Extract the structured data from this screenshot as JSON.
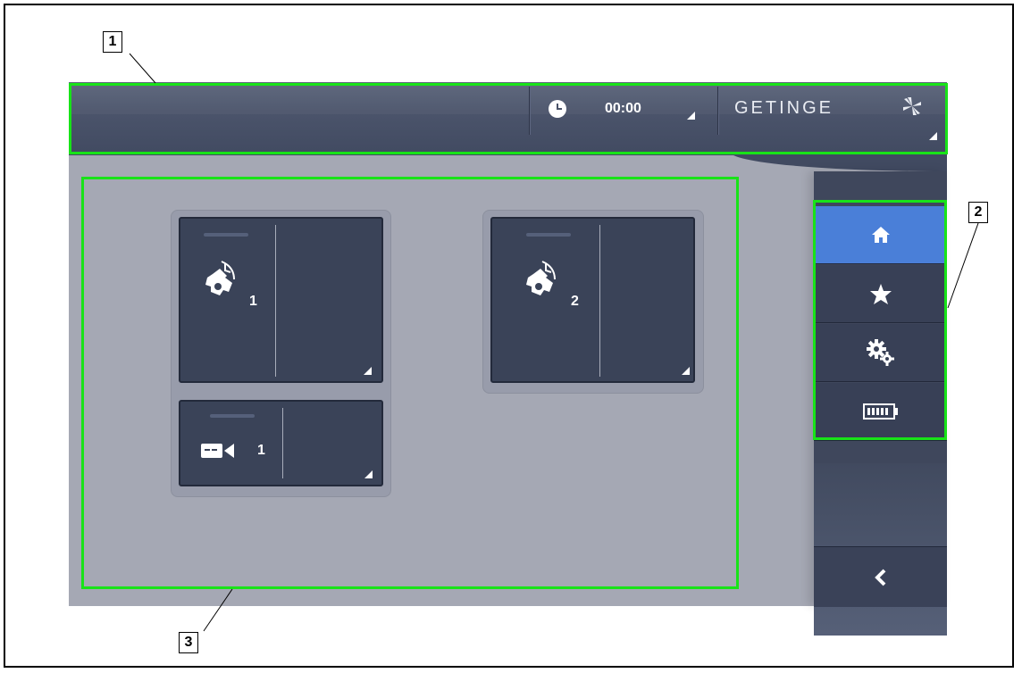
{
  "topbar": {
    "time": "00:00",
    "brand": "GETINGE"
  },
  "tiles": [
    {
      "name": "light-head-1",
      "number": "1"
    },
    {
      "name": "light-head-2",
      "number": "2"
    },
    {
      "name": "camera",
      "number": "1"
    }
  ],
  "nav": {
    "items": [
      {
        "name": "home",
        "active": true
      },
      {
        "name": "favorites",
        "active": false
      },
      {
        "name": "settings",
        "active": false
      },
      {
        "name": "battery",
        "active": false
      }
    ]
  },
  "callouts": [
    "1",
    "2",
    "3"
  ],
  "colors": {
    "highlight": "#18e318",
    "active_nav": "#4a7fd8",
    "tile": "#3a4358"
  }
}
